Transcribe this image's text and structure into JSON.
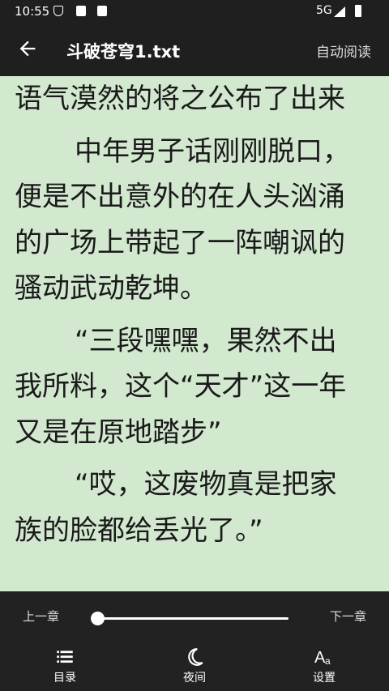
{
  "status_bar": {
    "time": "10:55",
    "network": "5G"
  },
  "app_bar": {
    "title": "斗破苍穹1.txt",
    "auto_read": "自动阅读"
  },
  "reader": {
    "lines": [
      {
        "text": "语气漠然的将之公布了出来",
        "indent": false,
        "new_para": false
      },
      {
        "text": "中年男子话刚刚脱口，",
        "indent": true,
        "new_para": true
      },
      {
        "text": "便是不出意外的在人头汹涌",
        "indent": false,
        "new_para": false
      },
      {
        "text": "的广场上带起了一阵嘲讽的",
        "indent": false,
        "new_para": false
      },
      {
        "text": "骚动武动乾坤。",
        "indent": false,
        "new_para": false
      },
      {
        "text": "“三段嘿嘿，果然不出",
        "indent": true,
        "new_para": true
      },
      {
        "text": "我所料，这个“天才”这一年",
        "indent": false,
        "new_para": false
      },
      {
        "text": "又是在原地踏步”",
        "indent": false,
        "new_para": false
      },
      {
        "text": "“哎，这废物真是把家",
        "indent": true,
        "new_para": true
      },
      {
        "text": "族的脸都给丢光了。”",
        "indent": false,
        "new_para": false
      }
    ],
    "background_color": "#d2e8cf"
  },
  "bottom_panel": {
    "prev_chapter": "上一章",
    "next_chapter": "下一章",
    "progress": 0.0,
    "nav": [
      {
        "label": "目录",
        "icon": "list-icon"
      },
      {
        "label": "夜间",
        "icon": "moon-icon"
      },
      {
        "label": "设置",
        "icon": "font-size-icon"
      }
    ]
  }
}
